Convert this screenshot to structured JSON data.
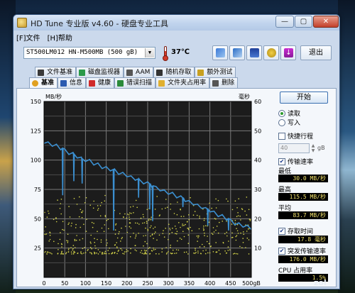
{
  "window": {
    "title": "HD Tune 专业版 v4.60 - 硬盘专业工具"
  },
  "window_controls": {
    "minimize": "—",
    "maximize": "▢",
    "close": "✕"
  },
  "menu": {
    "file": "[F]文件",
    "help": "[H]帮助"
  },
  "toolbar": {
    "drive": "ST500LM012 HN-M500MB   (500 gB)",
    "drive_arrow": "▼",
    "temperature": "37℃",
    "exit_label": "退出"
  },
  "tabs_row1": [
    "文件基准",
    "磁盘监视器",
    "AAM",
    "随机存取",
    "额外测试"
  ],
  "tabs_row2": [
    "基准",
    "信息",
    "健康",
    "错误扫描",
    "文件夹占用率",
    "删除"
  ],
  "chart_data": {
    "type": "line",
    "left_axis_label": "MB/秒",
    "right_axis_label": "毫秒",
    "left_ticks": [
      150,
      125,
      100,
      75,
      50,
      25
    ],
    "right_ticks": [
      60,
      50,
      40,
      30,
      20,
      10
    ],
    "x_ticks": [
      "0",
      "50",
      "100",
      "150",
      "200",
      "250",
      "300",
      "350",
      "400",
      "450",
      "500gB"
    ],
    "ylim": [
      0,
      150
    ],
    "xlim": [
      0,
      500
    ],
    "right_ylim": [
      0,
      60
    ],
    "grid": true,
    "transfer_rate": {
      "x": [
        0,
        10,
        20,
        30,
        40,
        50,
        60,
        70,
        80,
        90,
        100,
        110,
        120,
        130,
        140,
        150,
        160,
        170,
        180,
        190,
        200,
        210,
        220,
        230,
        240,
        250,
        260,
        270,
        280,
        290,
        300,
        310,
        320,
        330,
        340,
        350,
        360,
        370,
        380,
        390,
        400,
        410,
        420,
        430,
        440,
        450,
        460,
        470,
        480,
        490,
        500
      ],
      "y": [
        115.5,
        114,
        113,
        112,
        110,
        108,
        106,
        105,
        103,
        101,
        100,
        99,
        97,
        96,
        94,
        93,
        92,
        91,
        89,
        88,
        87,
        85,
        84,
        82,
        81,
        80,
        78,
        76,
        75,
        73,
        72,
        71,
        69,
        68,
        66,
        64,
        63,
        61,
        60,
        58,
        57,
        55,
        53,
        52,
        50,
        48,
        46,
        45,
        44,
        43,
        42
      ]
    },
    "dips": [
      {
        "x": 45,
        "y": 70
      },
      {
        "x": 72,
        "y": 82
      },
      {
        "x": 92,
        "y": 80
      },
      {
        "x": 160,
        "y": 52
      },
      {
        "x": 168,
        "y": 40
      },
      {
        "x": 200,
        "y": 75
      },
      {
        "x": 228,
        "y": 68
      },
      {
        "x": 255,
        "y": 58
      },
      {
        "x": 262,
        "y": 48
      },
      {
        "x": 300,
        "y": 62
      },
      {
        "x": 335,
        "y": 60
      },
      {
        "x": 350,
        "y": 56
      },
      {
        "x": 380,
        "y": 28
      },
      {
        "x": 395,
        "y": 44
      },
      {
        "x": 420,
        "y": 35
      },
      {
        "x": 445,
        "y": 40
      },
      {
        "x": 470,
        "y": 42
      }
    ],
    "access_time_scatter_range_ms": [
      8,
      28
    ],
    "colors": {
      "background": "#1c1c1c",
      "grid": "#7a7a7a",
      "line": "#3b8fd0",
      "scatter": "#d8d84a"
    }
  },
  "side": {
    "start": "开始",
    "read": "读取",
    "write": "写入",
    "short_stroke": "快捷行程",
    "short_stroke_value": "40",
    "short_stroke_unit": "gB",
    "transfer_rate": "传输速率",
    "min_label": "最低",
    "min_value": "30.0 MB/秒",
    "max_label": "最高",
    "max_value": "115.5 MB/秒",
    "avg_label": "平均",
    "avg_value": "83.7 MB/秒",
    "access_time": "存取时间",
    "access_value": "17.8 毫秒",
    "burst_rate": "突发传输速率",
    "burst_value": "176.0 MB/秒",
    "cpu_usage": "CPU 占用率",
    "cpu_value": "1.5%"
  },
  "watermark": "zol"
}
